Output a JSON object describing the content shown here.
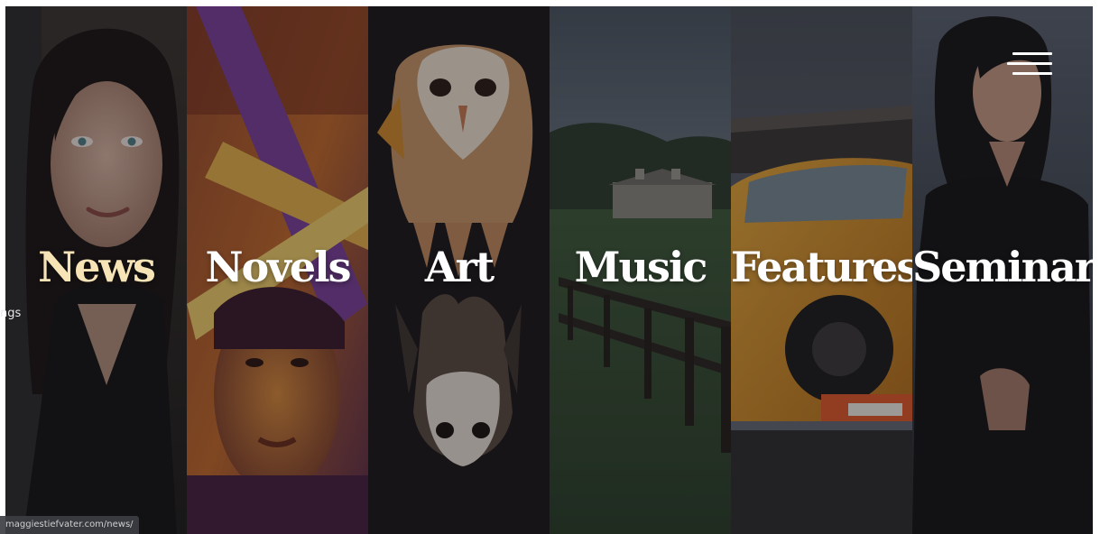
{
  "panels": [
    {
      "label": "News",
      "active": true,
      "image": "portrait-of-woman-with-dark-hair"
    },
    {
      "label": "Novels",
      "active": false,
      "image": "painted-woman-with-crossed-swords"
    },
    {
      "label": "Art",
      "active": false,
      "image": "owl-hand-illustration"
    },
    {
      "label": "Music",
      "active": false,
      "image": "farm-field-with-fence-and-barn"
    },
    {
      "label": "Features",
      "active": false,
      "image": "orange-race-car"
    },
    {
      "label": "Seminar",
      "active": false,
      "image": "woman-in-leather-jacket"
    }
  ],
  "menu": {
    "icon": "hamburger-menu-icon"
  },
  "left_peek_text": "ngs",
  "status_url": "maggiestiefvater.com/news/",
  "colors": {
    "active_label": "#f6e3b6",
    "label": "#ffffff",
    "overlay": "#0f1116"
  }
}
